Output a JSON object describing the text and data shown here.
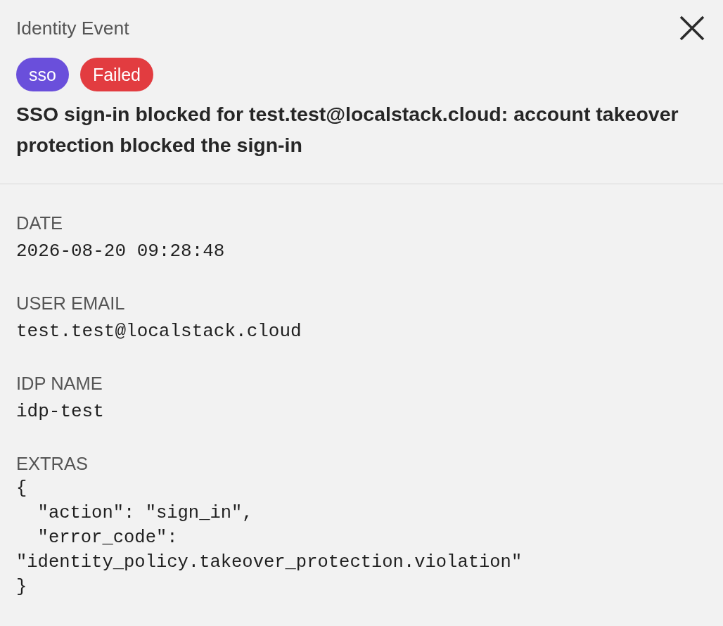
{
  "panel": {
    "title": "Identity Event"
  },
  "tags": [
    {
      "label": "sso",
      "color": "#6a4fdb"
    },
    {
      "label": "Failed",
      "color": "#e23c40"
    }
  ],
  "heading": "SSO sign-in blocked for test.test@localstack.cloud: account takeover protection blocked the sign-in",
  "fields": [
    {
      "kind": "text",
      "label": "DATE",
      "value": "2026-08-20 09:28:48"
    },
    {
      "kind": "text",
      "label": "USER EMAIL",
      "value": "test.test@localstack.cloud"
    },
    {
      "kind": "text",
      "label": "IDP NAME",
      "value": "idp-test"
    },
    {
      "kind": "code",
      "label": "EXTRAS",
      "lines": [
        "{",
        "  \"action\": \"sign_in\",",
        "  \"error_code\":",
        "\"identity_policy.takeover_protection.violation\"",
        "}"
      ]
    }
  ]
}
